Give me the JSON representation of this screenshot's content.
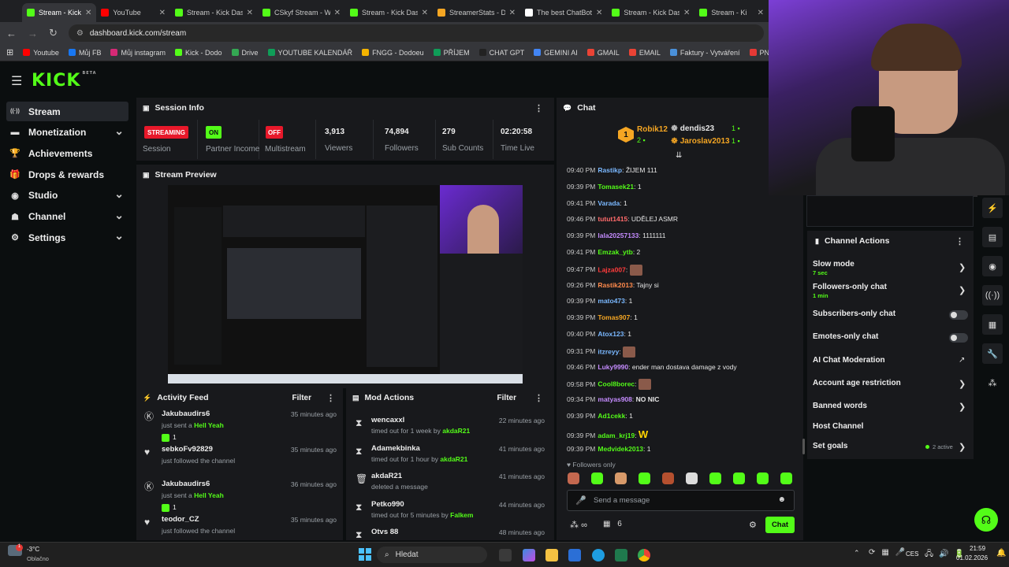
{
  "browser": {
    "tabs": [
      {
        "label": "Stream - Kick",
        "active": true,
        "color": "#53fc18"
      },
      {
        "label": "YouTube",
        "color": "#ff0000"
      },
      {
        "label": "Stream - Kick Das",
        "color": "#53fc18"
      },
      {
        "label": "CSkyf Stream - W",
        "color": "#53fc18"
      },
      {
        "label": "Stream - Kick Das",
        "color": "#53fc18"
      },
      {
        "label": "StreamerStats - D",
        "color": "#f5a623"
      },
      {
        "label": "The best ChatBot",
        "color": "#ffffff"
      },
      {
        "label": "Stream - Kick Das",
        "color": "#53fc18"
      },
      {
        "label": "Stream - Ki",
        "color": "#53fc18"
      }
    ],
    "url": "dashboard.kick.com/stream",
    "bookmarks": [
      {
        "label": "Youtube",
        "color": "#ff0000"
      },
      {
        "label": "Můj FB",
        "color": "#1877f2"
      },
      {
        "label": "Můj instagram",
        "color": "#d62976"
      },
      {
        "label": "Kick - Dodo",
        "color": "#53fc18"
      },
      {
        "label": "Drive",
        "color": "#34a853"
      },
      {
        "label": "YOUTUBE KALENDÁŘ",
        "color": "#0f9d58"
      },
      {
        "label": "FNGG - Dodoeu",
        "color": "#f4b400"
      },
      {
        "label": "PŘÍJEM",
        "color": "#0f9d58"
      },
      {
        "label": "CHAT GPT",
        "color": "#222222"
      },
      {
        "label": "GEMINI AI",
        "color": "#4285f4"
      },
      {
        "label": "GMAIL",
        "color": "#ea4335"
      },
      {
        "label": "EMAIL",
        "color": "#ea4335"
      },
      {
        "label": "Faktury - Vytváření",
        "color": "#4a90d9"
      },
      {
        "label": "PNG to PDF",
        "color": "#e53935"
      }
    ]
  },
  "brand": {
    "logo": "KICK",
    "beta": "BETA",
    "accent": "#53fc18"
  },
  "sidebar": {
    "items": [
      {
        "label": "Stream",
        "icon": "broadcast-icon",
        "glyph": "((·))",
        "active": true
      },
      {
        "label": "Monetization",
        "icon": "money-icon",
        "glyph": "▬",
        "chevron": true
      },
      {
        "label": "Achievements",
        "icon": "trophy-icon",
        "glyph": "🏆"
      },
      {
        "label": "Drops & rewards",
        "icon": "gift-icon",
        "glyph": "🎁"
      },
      {
        "label": "Studio",
        "icon": "studio-icon",
        "glyph": "◉",
        "chevron": true
      },
      {
        "label": "Channel",
        "icon": "channel-icon",
        "glyph": "☗",
        "chevron": true
      },
      {
        "label": "Settings",
        "icon": "gear-icon",
        "glyph": "⚙",
        "chevron": true
      }
    ]
  },
  "session": {
    "title": "Session Info",
    "streaming_badge": "STREAMING",
    "session_label": "Session",
    "partner_badge": "ON",
    "partner_label": "Partner Income",
    "multistream_badge": "OFF",
    "multistream_label": "Multistream",
    "stats": [
      {
        "value": "3,913",
        "label": "Viewers"
      },
      {
        "value": "74,894",
        "label": "Followers"
      },
      {
        "value": "279",
        "label": "Sub Counts"
      },
      {
        "value": "02:20:58",
        "label": "Time Live"
      }
    ]
  },
  "preview": {
    "title": "Stream Preview"
  },
  "activity": {
    "title": "Activity Feed",
    "filter": "Filter",
    "items": [
      {
        "name": "Jakubaudirs6",
        "text": "just sent a",
        "highlight": "Hell Yeah",
        "count": "1",
        "time": "35 minutes ago",
        "icon": "kick-icon"
      },
      {
        "name": "sebkoFv92829",
        "text": "just followed the channel",
        "time": "35 minutes ago",
        "icon": "heart-icon"
      },
      {
        "name": "Jakubaudirs6",
        "text": "just sent a",
        "highlight": "Hell Yeah",
        "count": "1",
        "time": "36 minutes ago",
        "icon": "kick-icon"
      },
      {
        "name": "teodor_CZ",
        "text": "just followed the channel",
        "time": "35 minutes ago",
        "icon": "heart-icon"
      }
    ]
  },
  "modactions": {
    "title": "Mod Actions",
    "filter": "Filter",
    "items": [
      {
        "name": "wencaxxl",
        "text": "timed out for 1 week by",
        "by": "akdaR21",
        "time": "22 minutes ago",
        "icon": "hourglass-icon"
      },
      {
        "name": "Adamekbinka",
        "text": "timed out for 1 hour by",
        "by": "akdaR21",
        "time": "41 minutes ago",
        "icon": "hourglass-icon"
      },
      {
        "name": "akdaR21",
        "text": "deleted a message",
        "by": "",
        "time": "41 minutes ago",
        "icon": "trash-icon"
      },
      {
        "name": "Petko990",
        "text": "timed out for 5 minutes by",
        "by": "Falkem",
        "time": "44 minutes ago",
        "icon": "hourglass-icon"
      },
      {
        "name": "Otvs 88",
        "text": "",
        "by": "",
        "time": "48 minutes ago",
        "icon": "hourglass-icon"
      }
    ]
  },
  "chat": {
    "title": "Chat",
    "top": [
      {
        "rank": "1",
        "name": "Robik12",
        "count": "2",
        "color": "#f5a623"
      },
      {
        "name": "dendis23",
        "count": "1",
        "color": "#e6e6e6"
      },
      {
        "name": "Jaroslav2013",
        "count": "1",
        "color": "#f5a623"
      }
    ],
    "messages": [
      {
        "time": "09:40 PM",
        "user": "Rastikp",
        "color": "#7ab8ff",
        "text": "ŽIJEM 111"
      },
      {
        "time": "09:39 PM",
        "user": "Tomasek21",
        "color": "#53fc18",
        "text": "1"
      },
      {
        "time": "09:41 PM",
        "user": "Varada",
        "color": "#7ab8ff",
        "text": "1"
      },
      {
        "time": "09:46 PM",
        "user": "tutut1415",
        "color": "#ff6b6b",
        "text": "UDĚLEJ ASMR"
      },
      {
        "time": "09:39 PM",
        "user": "lala20257133",
        "color": "#c58cff",
        "text": "1111111"
      },
      {
        "time": "09:41 PM",
        "user": "Emzak_ytb",
        "color": "#53fc18",
        "text": "2"
      },
      {
        "time": "09:47 PM",
        "user": "Lajza007",
        "color": "#ff3b3b",
        "text": ""
      },
      {
        "time": "09:26 PM",
        "user": "Rastik2013",
        "color": "#ff8a4c",
        "text": "Tajny si"
      },
      {
        "time": "09:39 PM",
        "user": "mato473",
        "color": "#7ab8ff",
        "text": "1"
      },
      {
        "time": "09:39 PM",
        "user": "Tomas907",
        "color": "#f5a623",
        "text": "1"
      },
      {
        "time": "09:40 PM",
        "user": "Atox123",
        "color": "#7ab8ff",
        "text": "1"
      },
      {
        "time": "09:31 PM",
        "user": "itzreyy",
        "color": "#7ab8ff",
        "text": ""
      },
      {
        "time": "09:46 PM",
        "user": "Luky9990",
        "color": "#c58cff",
        "text": "ender man dostava damage z vody"
      },
      {
        "time": "09:58 PM",
        "user": "Cool8borec",
        "color": "#53fc18",
        "text": ""
      },
      {
        "time": "09:34 PM",
        "user": "matyas908",
        "color": "#c58cff",
        "text": "NO NIC"
      },
      {
        "time": "09:39 PM",
        "user": "Ad1cekk",
        "color": "#53fc18",
        "text": "1"
      },
      {
        "time": "09:39 PM",
        "user": "adam_krj19",
        "color": "#53fc18",
        "text": "W"
      },
      {
        "time": "09:39 PM",
        "user": "Medvidek2013",
        "color": "#53fc18",
        "text": "1"
      }
    ],
    "followers_only": "Followers only",
    "placeholder": "Send a message",
    "viewers_icon_label": "∞",
    "gifts": "6",
    "send_label": "Chat"
  },
  "channel_actions": {
    "title": "Channel Actions",
    "items": [
      {
        "label": "Slow mode",
        "sub": "7 sec",
        "control": "chevron"
      },
      {
        "label": "Followers-only chat",
        "sub": "1 min",
        "control": "chevron"
      },
      {
        "label": "Subscribers-only chat",
        "control": "toggle"
      },
      {
        "label": "Emotes-only chat",
        "control": "toggle"
      },
      {
        "label": "AI Chat Moderation",
        "control": "external"
      },
      {
        "label": "Account age restriction",
        "control": "chevron"
      },
      {
        "label": "Banned words",
        "control": "chevron"
      },
      {
        "label": "Host Channel",
        "control": "none"
      },
      {
        "label": "Set goals",
        "status": "2 active",
        "control": "chevron"
      }
    ]
  },
  "taskbar": {
    "weather_temp": "-3°C",
    "weather_desc": "Oblačno",
    "search": "Hledat",
    "lang": "CES",
    "time": "21:59",
    "date": "01.02.2026"
  }
}
